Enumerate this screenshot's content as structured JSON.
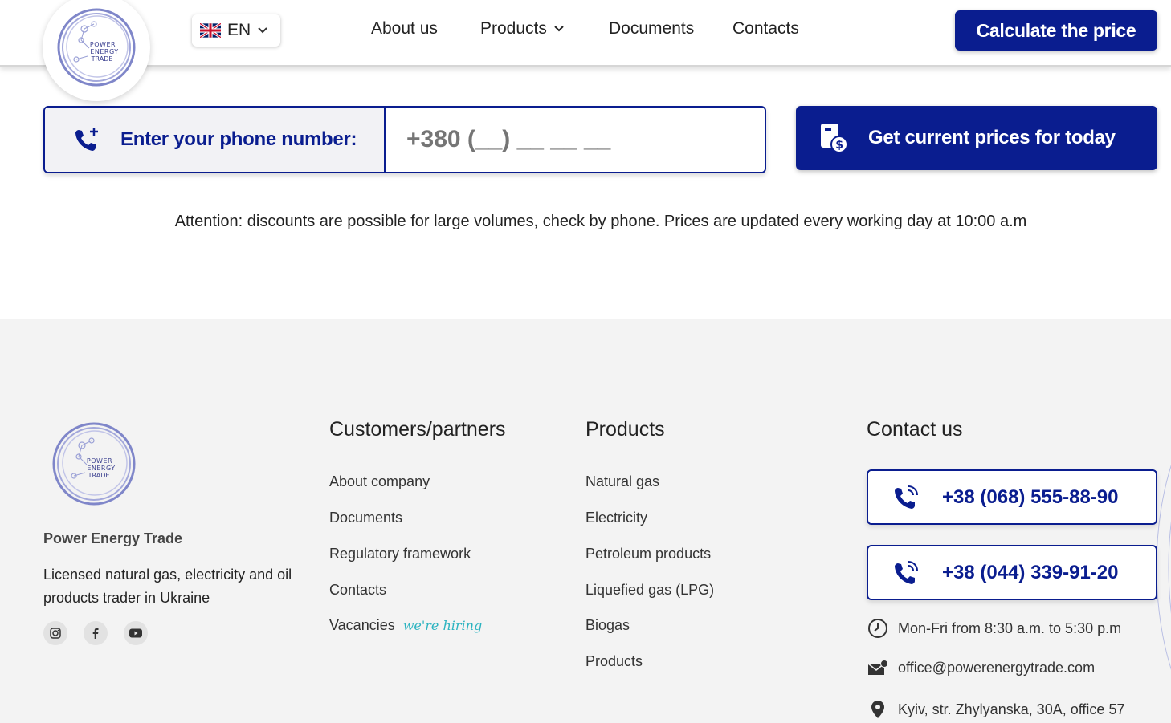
{
  "header": {
    "logo_text": [
      "POWER",
      "ENERGY",
      "TRADE"
    ],
    "language": "EN",
    "nav": [
      "About us",
      "Products",
      "Documents",
      "Contacts"
    ],
    "cta": "Calculate the price"
  },
  "form": {
    "label": "Enter your phone number:",
    "phone_placeholder": "+380 (__) __ __ __",
    "button": "Get current prices for today",
    "attention": "Attention: discounts are possible for large volumes, check by phone. Prices are updated every working day at 10:00 a.m"
  },
  "footer": {
    "logo_text": [
      "POWER",
      "ENERGY",
      "TRADE"
    ],
    "company": "Power Energy Trade",
    "description": "Licensed natural gas, electricity and oil products trader in Ukraine",
    "customers": {
      "title": "Customers/partners",
      "links": [
        "About company",
        "Documents",
        "Regulatory framework",
        "Contacts",
        "Vacancies"
      ],
      "hiring_badge": "we're hiring"
    },
    "products": {
      "title": "Products",
      "links": [
        "Natural gas",
        "Electricity",
        "Petroleum products",
        "Liquefied gas (LPG)",
        "Biogas",
        "Products"
      ]
    },
    "contact": {
      "title": "Contact us",
      "phones": [
        "+38 (068) 555-88-90",
        "+38 (044) 339-91-20"
      ],
      "hours": "Mon-Fri from 8:30 a.m. to 5:30 p.m",
      "email": "office@powerenergytrade.com",
      "address": "Kyiv, str. Zhylyanska, 30A, office 57"
    }
  },
  "colors": {
    "brand": "#0a1d8f",
    "accent": "#2bb3c0",
    "footer_bg": "#f3f3f3"
  }
}
